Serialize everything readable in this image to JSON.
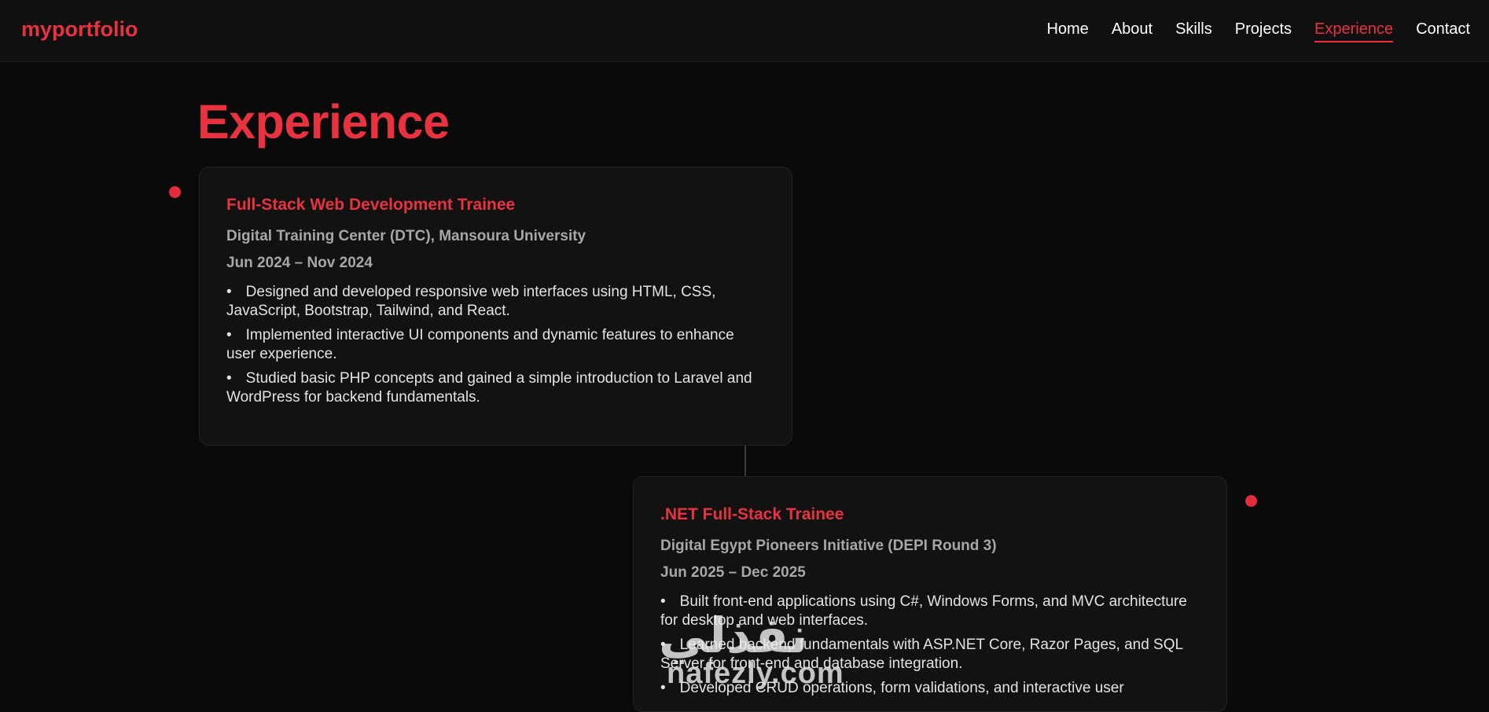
{
  "header": {
    "logo": "myportfolio",
    "nav": [
      {
        "label": "Home",
        "active": false
      },
      {
        "label": "About",
        "active": false
      },
      {
        "label": "Skills",
        "active": false
      },
      {
        "label": "Projects",
        "active": false
      },
      {
        "label": "Experience",
        "active": true
      },
      {
        "label": "Contact",
        "active": false
      }
    ]
  },
  "main": {
    "title": "Experience",
    "experiences": [
      {
        "role": "Full-Stack Web Development Trainee",
        "org": "Digital Training Center (DTC), Mansoura University",
        "dates": "Jun 2024 – Nov 2024",
        "bullets": [
          "Designed and developed responsive web interfaces using HTML, CSS, JavaScript, Bootstrap, Tailwind, and React.",
          "Implemented interactive UI components and dynamic features to enhance user experience.",
          "Studied basic PHP concepts and gained a simple introduction to Laravel and WordPress for backend fundamentals."
        ]
      },
      {
        "role": ".NET Full-Stack Trainee",
        "org": "Digital Egypt Pioneers Initiative (DEPI Round 3)",
        "dates": "Jun 2025 – Dec 2025",
        "bullets": [
          "Built front-end applications using C#, Windows Forms, and MVC architecture for desktop and web interfaces.",
          "Learned backend fundamentals with ASP.NET Core, Razor Pages, and SQL Server for front-end and database integration.",
          "Developed CRUD operations, form validations, and interactive user"
        ]
      }
    ]
  },
  "watermark": {
    "arabic": "نفذلي",
    "latin": "nafezly.com"
  },
  "colors": {
    "accent": "#e8323f",
    "background": "#0a0a0a",
    "card": "#121212",
    "muted_text": "#a7a7a7"
  }
}
